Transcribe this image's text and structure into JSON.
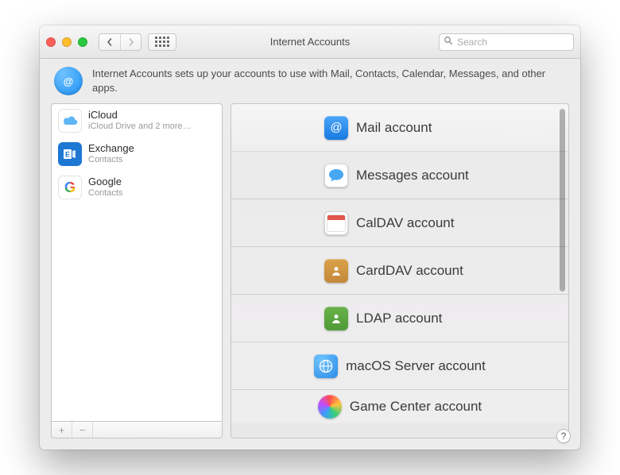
{
  "window": {
    "title": "Internet Accounts"
  },
  "search": {
    "placeholder": "Search"
  },
  "header": {
    "description": "Internet Accounts sets up your accounts to use with Mail, Contacts, Calendar, Messages, and other apps."
  },
  "accounts": [
    {
      "name": "iCloud",
      "sub": "iCloud Drive and 2 more…",
      "icon": "icloud-icon"
    },
    {
      "name": "Exchange",
      "sub": "Contacts",
      "icon": "exchange-icon"
    },
    {
      "name": "Google",
      "sub": "Contacts",
      "icon": "google-icon"
    }
  ],
  "providers": [
    {
      "label": "Mail account",
      "icon": "mail-icon"
    },
    {
      "label": "Messages account",
      "icon": "messages-icon"
    },
    {
      "label": "CalDAV account",
      "icon": "caldav-icon"
    },
    {
      "label": "CardDAV account",
      "icon": "carddav-icon"
    },
    {
      "label": "LDAP account",
      "icon": "ldap-icon"
    },
    {
      "label": "macOS Server account",
      "icon": "server-icon"
    },
    {
      "label": "Game Center account",
      "icon": "gamecenter-icon"
    }
  ],
  "buttons": {
    "add": "+",
    "remove": "−",
    "help": "?"
  }
}
